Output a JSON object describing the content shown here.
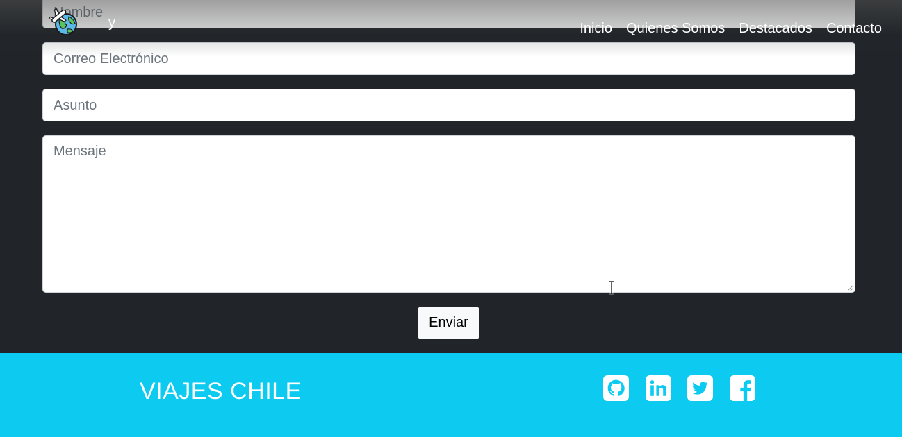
{
  "navbar": {
    "brand_fragment": "y",
    "links": [
      "Inicio",
      "Quienes Somos",
      "Destacados",
      "Contacto"
    ]
  },
  "form": {
    "name_placeholder": "Nombre",
    "email_placeholder": "Correo Electrónico",
    "subject_placeholder": "Asunto",
    "message_placeholder": "Mensaje",
    "send_label": "Enviar"
  },
  "footer": {
    "title": "VIAJES CHILE",
    "social_icons": [
      "github-icon",
      "linkedin-icon",
      "twitter-icon",
      "facebook-icon"
    ]
  },
  "colors": {
    "section_bg": "#212529",
    "footer_bg": "#0dcaf0",
    "button_bg": "#f8f9fa"
  }
}
